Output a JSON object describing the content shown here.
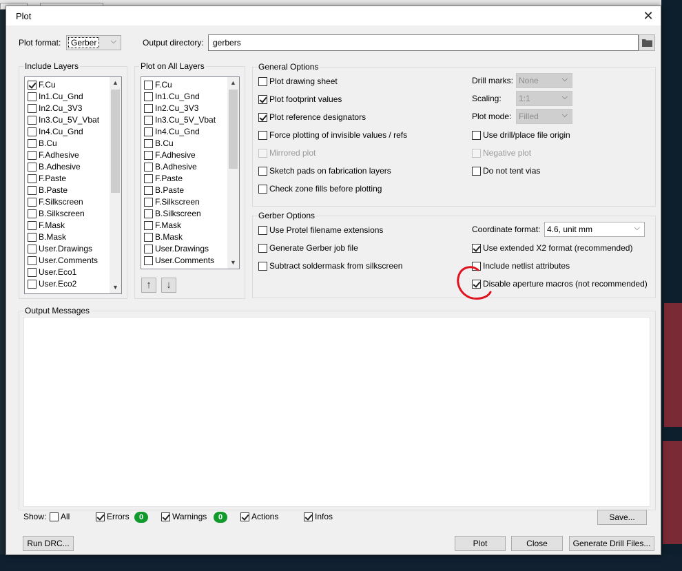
{
  "window": {
    "title": "Plot"
  },
  "format": {
    "label": "Plot format:",
    "value": "Gerber"
  },
  "output": {
    "label": "Output directory:",
    "value": "gerbers"
  },
  "include_layers": {
    "title": "Include Layers",
    "items": [
      {
        "label": "F.Cu",
        "checked": true
      },
      {
        "label": "In1.Cu_Gnd",
        "checked": false
      },
      {
        "label": "In2.Cu_3V3",
        "checked": false
      },
      {
        "label": "In3.Cu_5V_Vbat",
        "checked": false
      },
      {
        "label": "In4.Cu_Gnd",
        "checked": false
      },
      {
        "label": "B.Cu",
        "checked": false
      },
      {
        "label": "F.Adhesive",
        "checked": false
      },
      {
        "label": "B.Adhesive",
        "checked": false
      },
      {
        "label": "F.Paste",
        "checked": false
      },
      {
        "label": "B.Paste",
        "checked": false
      },
      {
        "label": "F.Silkscreen",
        "checked": false
      },
      {
        "label": "B.Silkscreen",
        "checked": false
      },
      {
        "label": "F.Mask",
        "checked": false
      },
      {
        "label": "B.Mask",
        "checked": false
      },
      {
        "label": "User.Drawings",
        "checked": false
      },
      {
        "label": "User.Comments",
        "checked": false
      },
      {
        "label": "User.Eco1",
        "checked": false
      },
      {
        "label": "User.Eco2",
        "checked": false
      }
    ]
  },
  "plot_all_layers": {
    "title": "Plot on All Layers",
    "items": [
      {
        "label": "F.Cu",
        "checked": false
      },
      {
        "label": "In1.Cu_Gnd",
        "checked": false
      },
      {
        "label": "In2.Cu_3V3",
        "checked": false
      },
      {
        "label": "In3.Cu_5V_Vbat",
        "checked": false
      },
      {
        "label": "In4.Cu_Gnd",
        "checked": false
      },
      {
        "label": "B.Cu",
        "checked": false
      },
      {
        "label": "F.Adhesive",
        "checked": false
      },
      {
        "label": "B.Adhesive",
        "checked": false
      },
      {
        "label": "F.Paste",
        "checked": false
      },
      {
        "label": "B.Paste",
        "checked": false
      },
      {
        "label": "F.Silkscreen",
        "checked": false
      },
      {
        "label": "B.Silkscreen",
        "checked": false
      },
      {
        "label": "F.Mask",
        "checked": false
      },
      {
        "label": "B.Mask",
        "checked": false
      },
      {
        "label": "User.Drawings",
        "checked": false
      },
      {
        "label": "User.Comments",
        "checked": false
      }
    ],
    "move_up_icon": "arrow-up-icon",
    "move_down_icon": "arrow-down-icon"
  },
  "general": {
    "title": "General Options",
    "plot_drawing_sheet": {
      "label": "Plot drawing sheet",
      "checked": false
    },
    "plot_footprint_values": {
      "label": "Plot footprint values",
      "checked": true
    },
    "plot_reference_designators": {
      "label": "Plot reference designators",
      "checked": true
    },
    "force_invisible": {
      "label": "Force plotting of invisible values / refs",
      "checked": false
    },
    "mirrored_plot": {
      "label": "Mirrored plot",
      "checked": false,
      "disabled": true
    },
    "sketch_pads": {
      "label": "Sketch pads on fabrication layers",
      "checked": false
    },
    "check_zone_fills": {
      "label": "Check zone fills before plotting",
      "checked": false
    },
    "drill_marks": {
      "label": "Drill marks:",
      "value": "None"
    },
    "scaling": {
      "label": "Scaling:",
      "value": "1:1"
    },
    "plot_mode": {
      "label": "Plot mode:",
      "value": "Filled"
    },
    "use_drill_origin": {
      "label": "Use drill/place file origin",
      "checked": false
    },
    "negative_plot": {
      "label": "Negative plot",
      "checked": false,
      "disabled": true
    },
    "do_not_tent_vias": {
      "label": "Do not tent vias",
      "checked": false
    }
  },
  "gerber": {
    "title": "Gerber Options",
    "protel_ext": {
      "label": "Use Protel filename extensions",
      "checked": false
    },
    "job_file": {
      "label": "Generate Gerber job file",
      "checked": false
    },
    "subtract_mask": {
      "label": "Subtract soldermask from silkscreen",
      "checked": false
    },
    "coord_format": {
      "label": "Coordinate format:",
      "value": "4.6, unit mm"
    },
    "x2_format": {
      "label": "Use extended X2 format (recommended)",
      "checked": true
    },
    "netlist_attrs": {
      "label": "Include netlist attributes",
      "checked": false
    },
    "disable_macros": {
      "label": "Disable aperture macros (not recommended)",
      "checked": true
    }
  },
  "messages": {
    "title": "Output Messages",
    "show_label": "Show:",
    "all": {
      "label": "All",
      "checked": false
    },
    "errors": {
      "label": "Errors",
      "checked": true,
      "count": "0"
    },
    "warnings": {
      "label": "Warnings",
      "checked": true,
      "count": "0"
    },
    "actions": {
      "label": "Actions",
      "checked": true
    },
    "infos": {
      "label": "Infos",
      "checked": true
    },
    "save_label": "Save..."
  },
  "buttons": {
    "run_drc": "Run DRC...",
    "plot": "Plot",
    "close": "Close",
    "generate_drill": "Generate Drill Files..."
  },
  "colors": {
    "badge": "#109a2b",
    "annotation": "#e0141e"
  }
}
